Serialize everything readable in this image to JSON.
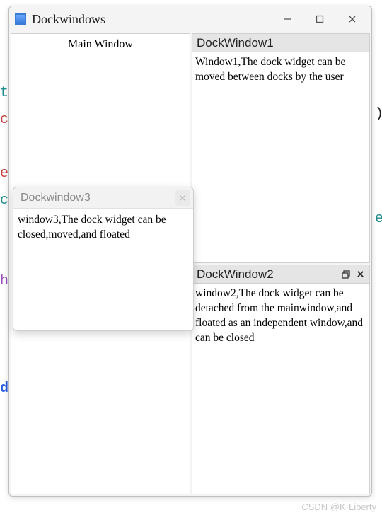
{
  "bg_fragments": {
    "t1": "t",
    "c1": "c",
    "e1": "e",
    "c2": "c",
    "h1": "h",
    "d1": "d",
    "paren": ")",
    "e2": "e"
  },
  "window": {
    "title": "Dockwindows"
  },
  "main": {
    "label": "Main Window"
  },
  "dock1": {
    "title": "DockWindow1",
    "body": "Window1,The dock widget can be moved between docks by the user"
  },
  "dock2": {
    "title": "DockWindow2",
    "body": "window2,The dock widget can be detached from the mainwindow,and floated as an independent window,and can be closed"
  },
  "dock3": {
    "title": "Dockwindow3",
    "body": "window3,The dock widget can be closed,moved,and floated"
  },
  "watermark": "CSDN @K·Liberty"
}
